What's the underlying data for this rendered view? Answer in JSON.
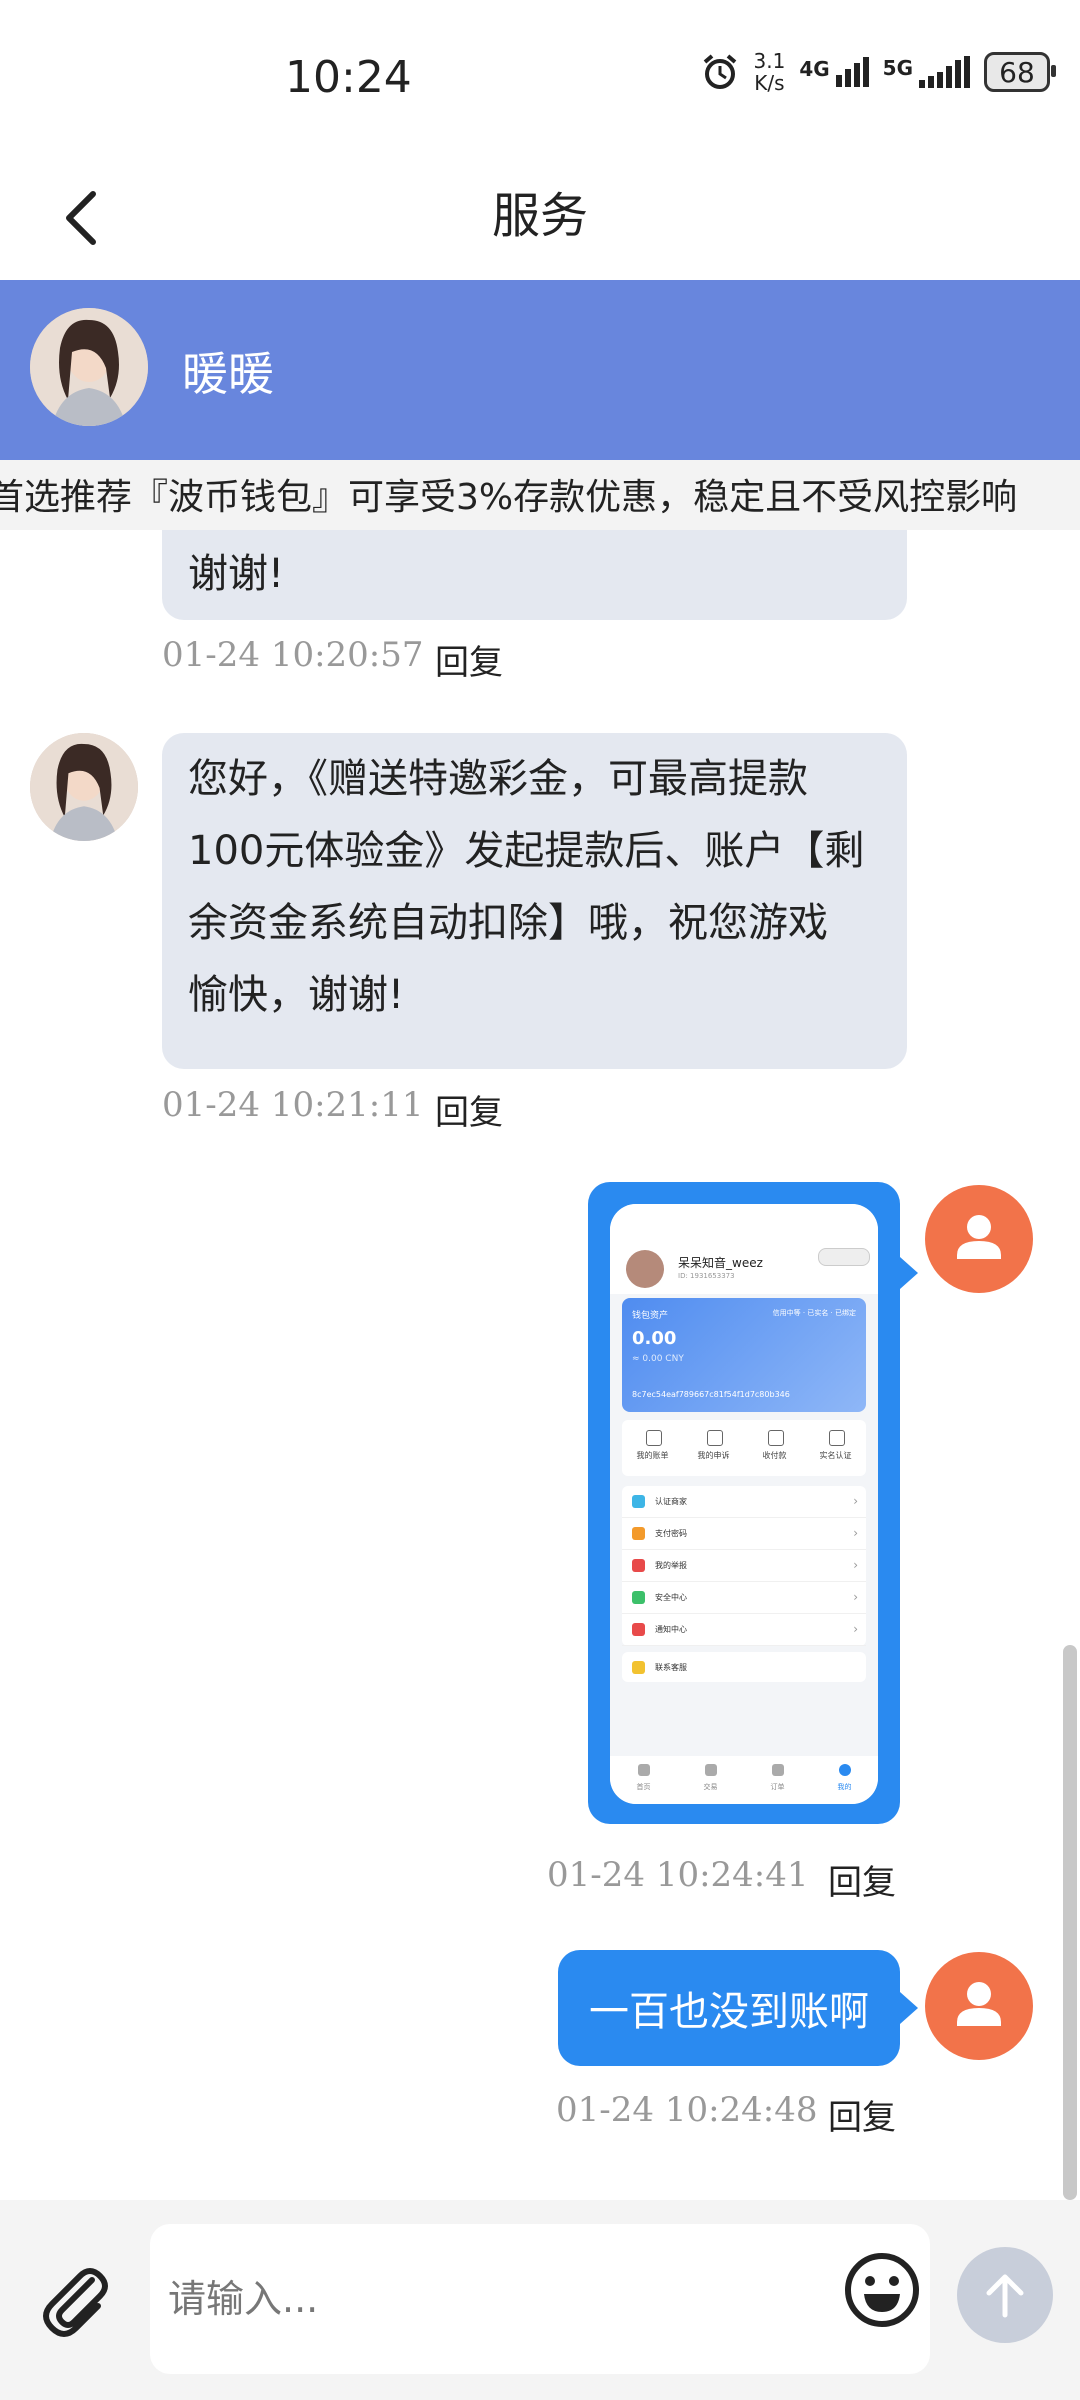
{
  "status_bar": {
    "time": "10:24",
    "net_speed_value": "3.1",
    "net_speed_unit": "K/s",
    "signal_1": "4G",
    "signal_2": "5G",
    "battery": "68"
  },
  "header": {
    "title": "服务",
    "back_icon": "chevron-left-icon"
  },
  "agent": {
    "name": "暖暖"
  },
  "notice": {
    "text": "首选推荐『波币钱包』可享受3%存款优惠，稳定且不受风控影响"
  },
  "messages": [
    {
      "from": "agent",
      "text": "谢谢!",
      "time": "01-24 10:20:57",
      "reply": "回复"
    },
    {
      "from": "agent",
      "text": "您好，《赠送特邀彩金，可最高提款100元体验金》发起提款后、账户【剩余资金系统自动扣除】哦，祝您游戏愉快，谢谢!",
      "time": "01-24 10:21:11",
      "reply": "回复"
    },
    {
      "from": "user",
      "type": "image",
      "time": "01-24 10:24:41",
      "reply": "回复"
    },
    {
      "from": "user",
      "text": "一百也没到账啊",
      "time": "01-24 10:24:48",
      "reply": "回复"
    }
  ],
  "screenshot": {
    "nickname": "呆呆知音_weez",
    "id_text": "ID: 1931653373",
    "wallet_title": "钱包资产",
    "tags": "信用中等 · 已实名 · 已绑定",
    "balance": "0.00",
    "balance_cny": "≈ 0.00 CNY",
    "address": "8c7ec54eaf789667c81f54f1d7c80b346",
    "quick": [
      "我的账单",
      "我的申诉",
      "收付款",
      "实名认证"
    ],
    "menu": [
      "认证商家",
      "支付密码",
      "我的举报",
      "安全中心",
      "通知中心"
    ],
    "contact": "联系客服",
    "tabs": [
      "首页",
      "交易",
      "订单",
      "我的"
    ]
  },
  "composer": {
    "placeholder": "请输入..."
  },
  "colors": {
    "banner": "#6886dd",
    "user_bubble": "#2a8af0",
    "agent_bubble": "#e4e8f0",
    "user_avatar": "#f2734a"
  }
}
